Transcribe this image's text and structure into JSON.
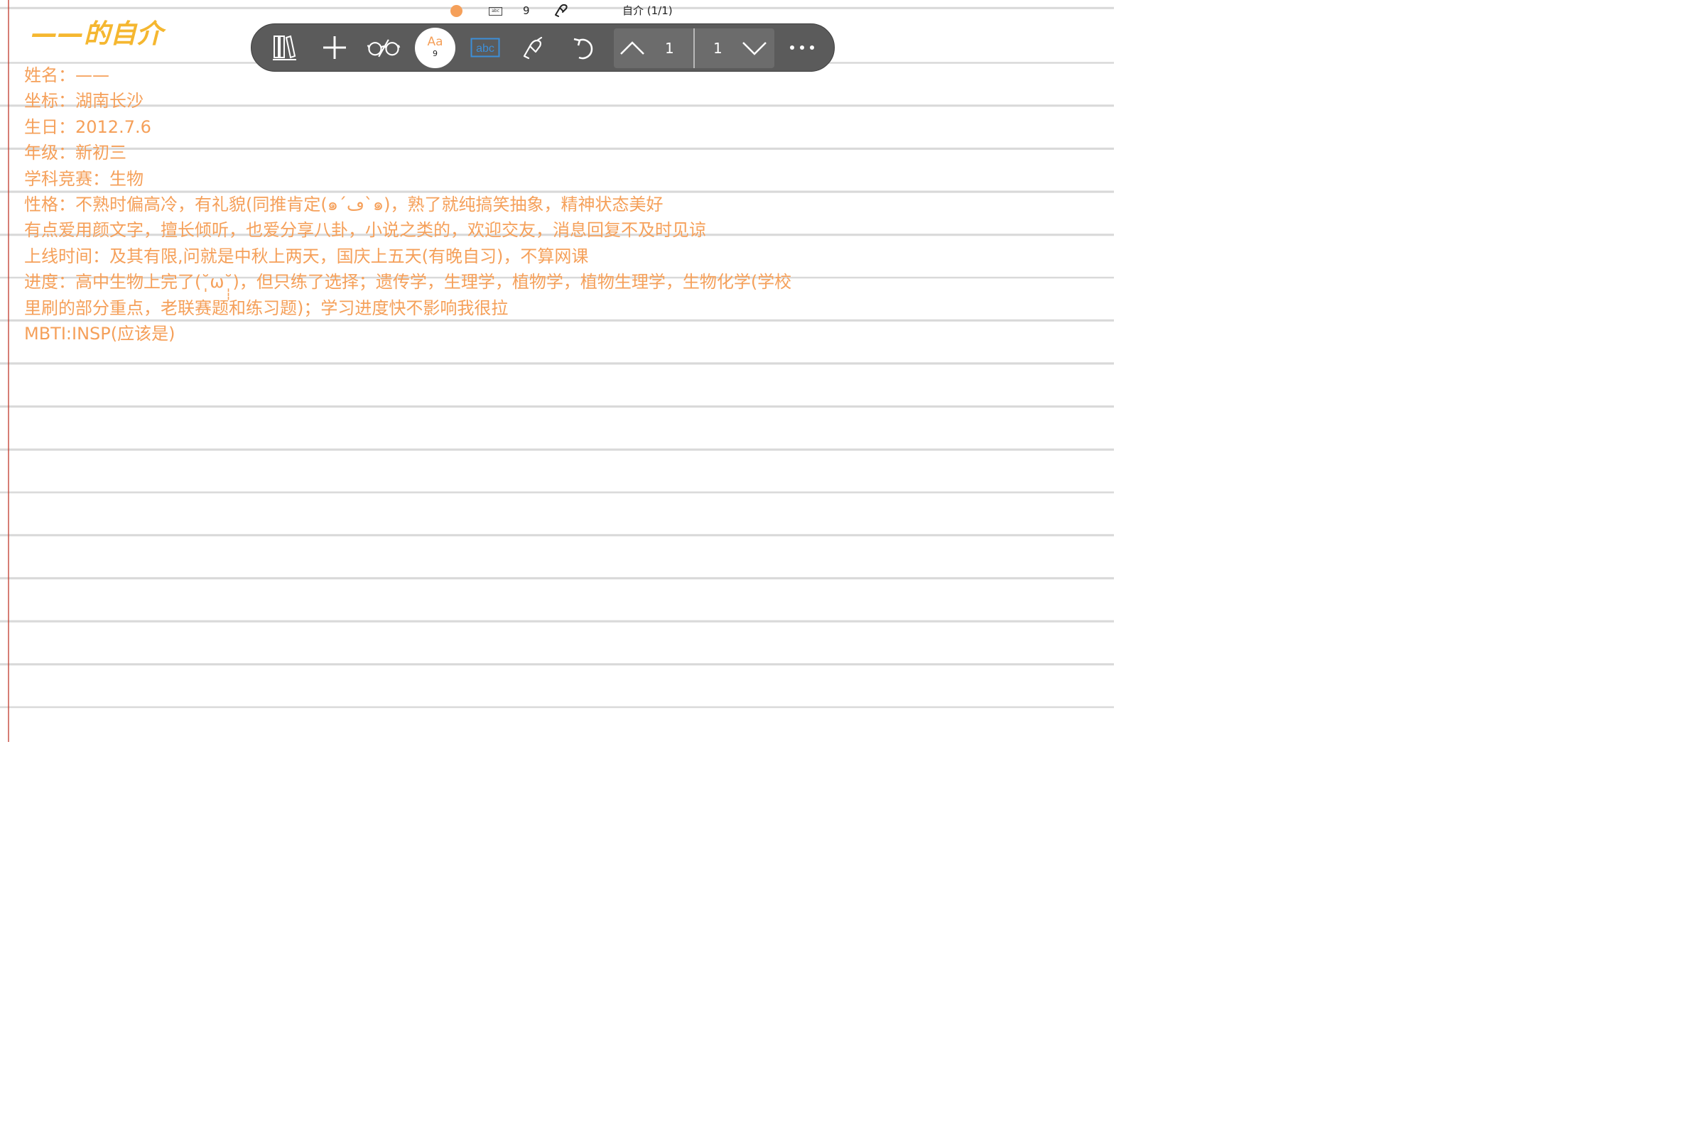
{
  "status": {
    "pen_color": "#f5a05a",
    "input_mode": "abc",
    "font_size": "9",
    "note_title": "自介 (1/1)"
  },
  "toolbar": {
    "font_button_label": "Aa",
    "font_button_size": "9",
    "text_mode_label": "abc",
    "current_page": "1",
    "total_pages": "1",
    "bg_color": "#5b5b5b"
  },
  "note": {
    "title": "——的自介",
    "title_color": "#f5b730",
    "text_color": "#f5a05a",
    "lines": [
      "姓名：——",
      "坐标：湖南长沙",
      "生日：2012.7.6",
      "年级：新初三",
      "学科竞赛：生物",
      "性格：不熟时偏高冷，有礼貌(同推肯定(๑´ڡ`๑)，熟了就纯搞笑抽象，精神状态美好",
      "有点爱用颜文字，擅长倾听，也爱分享八卦，小说之类的，欢迎交友，消息回复不及时见谅",
      "上线时间：及其有限,问就是中秋上两天，国庆上五天(有晚自习)，不算网课",
      "进度：高中生物上完了(˘̩̩̩ω˘̩̩̩)，但只练了选择；遗传学，生理学，植物学，植物生理学，生物化学(学校",
      "里刷的部分重点，老联赛题和练习题)；学习进度快不影响我很拉",
      "MBTI:INSP(应该是)"
    ]
  }
}
